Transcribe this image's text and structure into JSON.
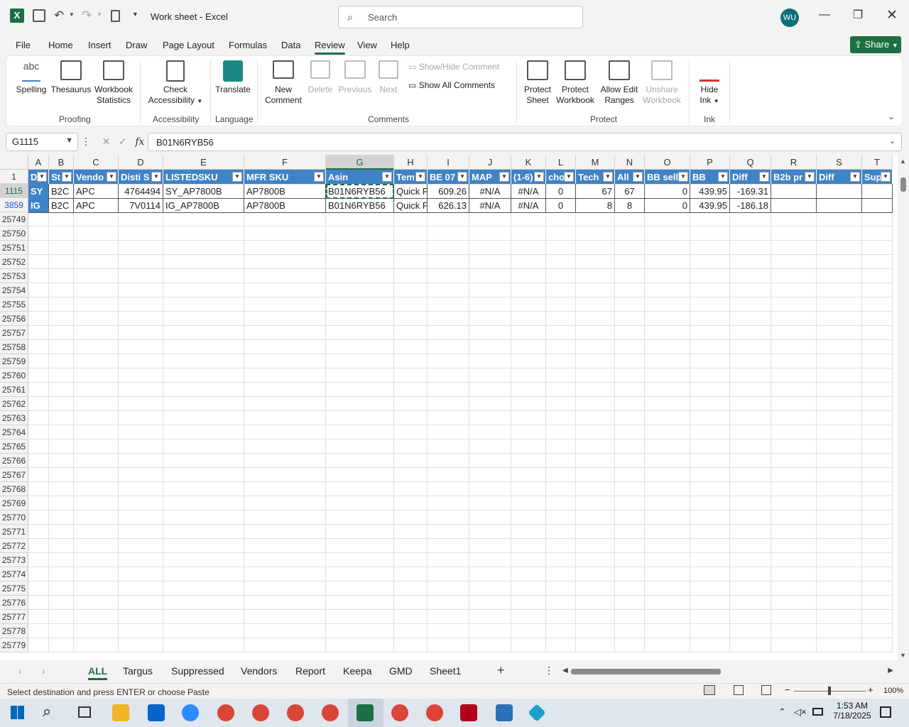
{
  "window": {
    "title": "Work sheet  -  Excel",
    "search_placeholder": "Search",
    "avatar": "WU"
  },
  "menu": [
    "File",
    "Home",
    "Insert",
    "Draw",
    "Page Layout",
    "Formulas",
    "Data",
    "Review",
    "View",
    "Help"
  ],
  "share": "Share",
  "ribbon": {
    "proofing": {
      "label": "Proofing",
      "spelling": "Spelling",
      "spelling_icon": "abc",
      "thesaurus": "Thesaurus",
      "stats1": "Workbook",
      "stats2": "Statistics"
    },
    "accessibility": {
      "label": "Accessibility",
      "check1": "Check",
      "check2": "Accessibility"
    },
    "language": {
      "label": "Language",
      "translate": "Translate"
    },
    "comments": {
      "label": "Comments",
      "new1": "New",
      "new2": "Comment",
      "delete": "Delete",
      "previous": "Previous",
      "next": "Next",
      "showhide": "Show/Hide Comment",
      "showall": "Show All Comments"
    },
    "protect": {
      "label": "Protect",
      "sheet1": "Protect",
      "sheet2": "Sheet",
      "wb1": "Protect",
      "wb2": "Workbook",
      "allow1": "Allow Edit",
      "allow2": "Ranges",
      "unshare1": "Unshare",
      "unshare2": "Workbook"
    },
    "ink": {
      "label": "Ink",
      "hide1": "Hide",
      "hide2": "Ink"
    }
  },
  "formula_bar": {
    "namebox": "G1115",
    "value": "B01N6RYB56"
  },
  "columns": [
    "A",
    "B",
    "C",
    "D",
    "E",
    "F",
    "G",
    "H",
    "I",
    "J",
    "K",
    "L",
    "M",
    "N",
    "O",
    "P",
    "Q",
    "R",
    "S",
    "T"
  ],
  "table_headers": [
    "D",
    "St",
    "Vendo",
    "Disti S",
    "LISTEDSKU",
    "MFR SKU",
    "Asin",
    "Tem",
    "BE 07",
    "MAP",
    "(1-6)",
    "cho",
    "Tech",
    "All",
    "BB sell",
    "BB",
    "Diff",
    "B2b pr",
    "Diff",
    "Sup"
  ],
  "row_numbers": [
    "1",
    "1115",
    "3859",
    "25749",
    "25750",
    "25751",
    "25752",
    "25753",
    "25754",
    "25755",
    "25756",
    "25757",
    "25758",
    "25759",
    "25760",
    "25761",
    "25762",
    "25763",
    "25764",
    "25765",
    "25766",
    "25767",
    "25768",
    "25769",
    "25770",
    "25771",
    "25772",
    "25773",
    "25774",
    "25775",
    "25776",
    "25777",
    "25778",
    "25779"
  ],
  "rows": [
    [
      "SY",
      "B2C",
      "APC",
      "4764494",
      "SY_AP7800B",
      "AP7800B",
      "B01N6RYB56",
      "Quick F",
      "609.26",
      "#N/A",
      "#N/A",
      "0",
      "67",
      "67",
      "0",
      "439.95",
      "-169.31",
      "",
      "",
      ""
    ],
    [
      "IG",
      "B2C",
      "APC",
      "7V0114",
      "IG_AP7800B",
      "AP7800B",
      "B01N6RYB56",
      "Quick F",
      "626.13",
      "#N/A",
      "#N/A",
      "0",
      "8",
      "8",
      "0",
      "439.95",
      "-186.18",
      "",
      "",
      ""
    ]
  ],
  "sheet_tabs": [
    "ALL",
    "Targus",
    "Suppressed",
    "Vendors",
    "Report",
    "Keepa",
    "GMD",
    "Sheet1"
  ],
  "status": {
    "text": "Select destination and press ENTER or choose Paste",
    "zoom": "100%"
  },
  "taskbar": {
    "time": "1:53 AM",
    "date": "7/18/2025"
  },
  "colors": {
    "excel_green": "#1d6f42",
    "header_blue": "#3f83c7"
  }
}
